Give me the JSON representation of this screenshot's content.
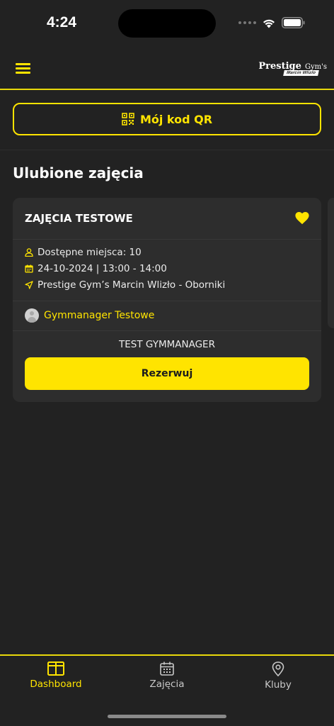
{
  "status_bar": {
    "time": "4:24"
  },
  "header": {
    "logo_brand": "Prestige",
    "logo_suffix": "Gym's",
    "logo_sub": "Marcin Wlizlo"
  },
  "qr_button": {
    "label": "Mój kod QR",
    "icon": "qr-code-icon"
  },
  "favorites": {
    "title": "Ulubione zajęcia",
    "cards": [
      {
        "name": "ZAJĘCIA TESTOWE",
        "favorite": true,
        "available_spots": "Dostępne miejsca: 10",
        "datetime": "24-10-2024 | 13:00 - 14:00",
        "location": "Prestige Gym’s Marcin Wlizło - Oborniki",
        "trainer": "Gymmanager Testowe",
        "subtitle": "TEST GYMMANAGER",
        "reserve_label": "Rezerwuj"
      }
    ]
  },
  "tabs": [
    {
      "label": "Dashboard",
      "icon": "dashboard-icon",
      "active": true
    },
    {
      "label": "Zajęcia",
      "icon": "calendar-icon",
      "active": false
    },
    {
      "label": "Kluby",
      "icon": "location-pin-icon",
      "active": false
    }
  ],
  "colors": {
    "accent": "#ffe400",
    "background": "#222222",
    "card": "#2d2d2d",
    "inactive_tab": "#c8c8c8"
  }
}
